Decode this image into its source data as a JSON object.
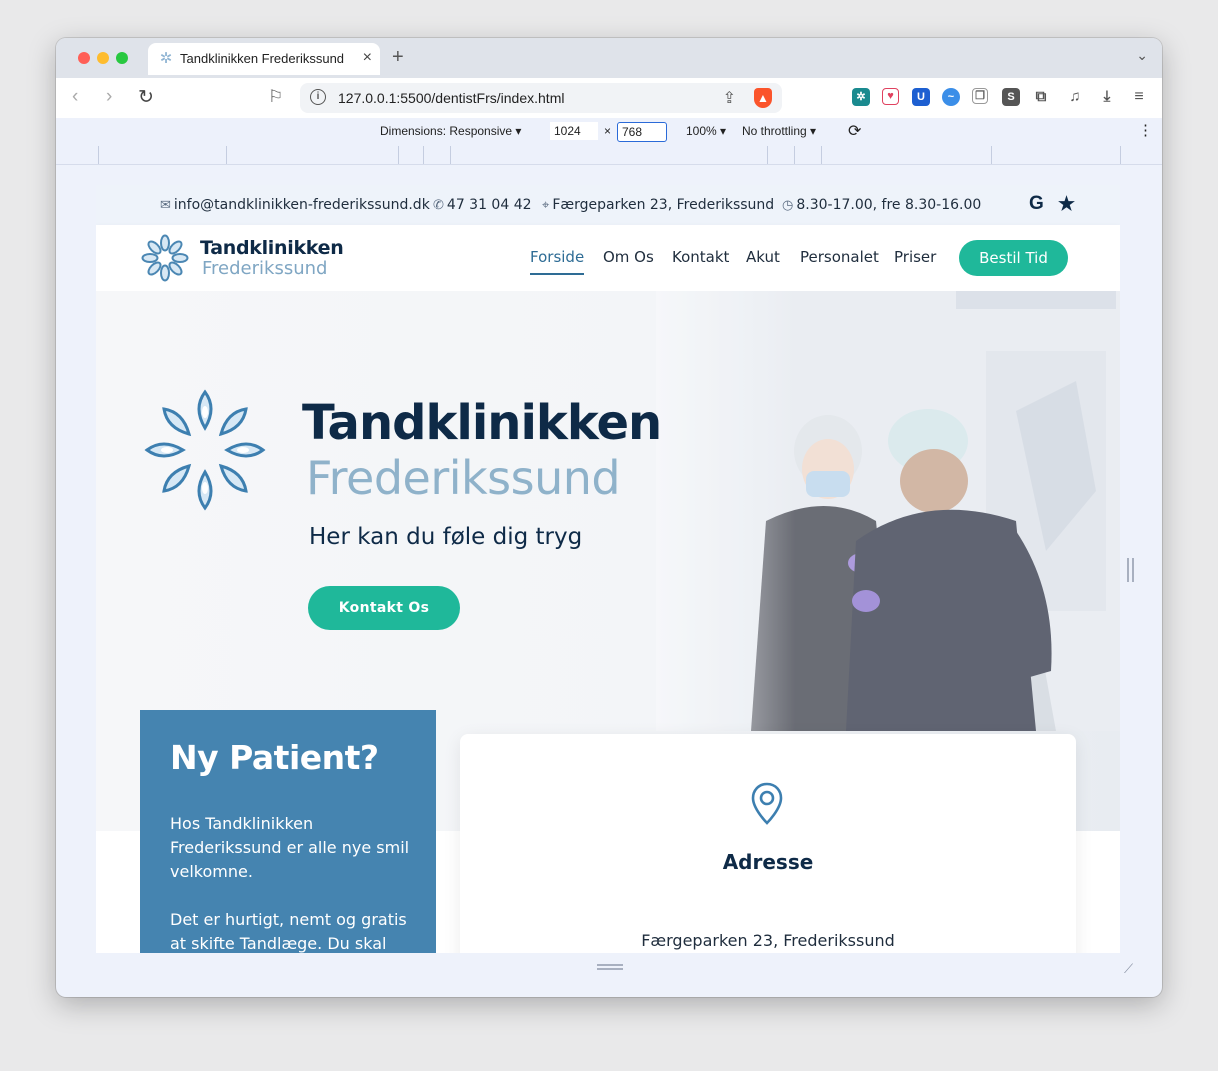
{
  "browser": {
    "tab_title": "Tandklinikken Frederikssund",
    "tab_close": "×",
    "new_tab": "+",
    "url": "127.0.0.1:5500/dentistFrs/index.html"
  },
  "responsive": {
    "dimensions_label": "Dimensions: Responsive",
    "width": "1024",
    "height": "768",
    "times": "×",
    "zoom": "100%",
    "throttling": "No throttling"
  },
  "topbar": {
    "email": "info@tandklinikken-frederikssund.dk",
    "phone": "47 31 04 42",
    "address": "Færgeparken 23, Frederikssund",
    "hours": "8.30-17.00, fre 8.30-16.00",
    "google": "G",
    "star": "★"
  },
  "header": {
    "logo_line1": "Tandklinikken",
    "logo_line2": "Frederikssund",
    "nav": [
      "Forside",
      "Om Os",
      "Kontakt",
      "Akut",
      "Personalet",
      "Priser"
    ],
    "cta": "Bestil Tid"
  },
  "hero": {
    "title1": "Tandklinikken",
    "title2": "Frederikssund",
    "tagline": "Her kan du føle dig tryg",
    "button": "Kontakt Os"
  },
  "patient": {
    "heading": "Ny Patient?",
    "p1": "Hos Tandklinikken Frederikssund er alle nye smil velkomne.",
    "p2": "Det er hurtigt, nemt og gratis at skifte Tandlæge. Du skal blot"
  },
  "address_card": {
    "title": "Adresse",
    "address": "Færgeparken 23, Frederikssund"
  },
  "colors": {
    "navy": "#0e2a47",
    "light_blue": "#8fb2ca",
    "teal": "#1fb89a",
    "panel_blue": "#4584b0"
  }
}
